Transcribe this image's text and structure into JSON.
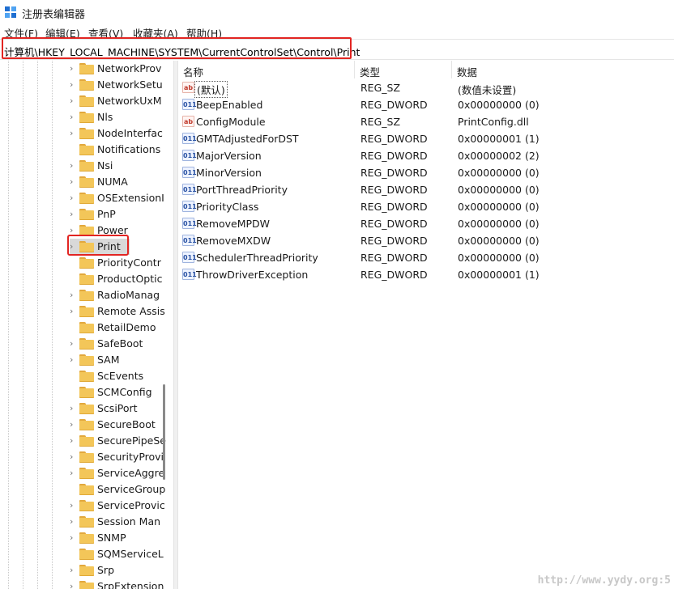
{
  "window": {
    "title": "注册表编辑器",
    "icon": "registry-editor-icon"
  },
  "menu": [
    "文件(F)",
    "编辑(E)",
    "查看(V)",
    "收藏夹(A)",
    "帮助(H)"
  ],
  "address": "计算机\\HKEY_LOCAL_MACHINE\\SYSTEM\\CurrentControlSet\\Control\\Print",
  "tree": {
    "items": [
      {
        "label": "NetworkProv",
        "expandable": true
      },
      {
        "label": "NetworkSetu",
        "expandable": true
      },
      {
        "label": "NetworkUxM",
        "expandable": true
      },
      {
        "label": "Nls",
        "expandable": true
      },
      {
        "label": "NodeInterfac",
        "expandable": true
      },
      {
        "label": "Notifications",
        "expandable": false
      },
      {
        "label": "Nsi",
        "expandable": true
      },
      {
        "label": "NUMA",
        "expandable": true
      },
      {
        "label": "OSExtensionI",
        "expandable": true
      },
      {
        "label": "PnP",
        "expandable": true
      },
      {
        "label": "Power",
        "expandable": true
      },
      {
        "label": "Print",
        "expandable": true,
        "selected": true
      },
      {
        "label": "PriorityContr",
        "expandable": false
      },
      {
        "label": "ProductOptic",
        "expandable": false
      },
      {
        "label": "RadioManag",
        "expandable": true
      },
      {
        "label": "Remote Assis",
        "expandable": true
      },
      {
        "label": "RetailDemo",
        "expandable": false
      },
      {
        "label": "SafeBoot",
        "expandable": true
      },
      {
        "label": "SAM",
        "expandable": true
      },
      {
        "label": "ScEvents",
        "expandable": false
      },
      {
        "label": "SCMConfig",
        "expandable": false
      },
      {
        "label": "ScsiPort",
        "expandable": true
      },
      {
        "label": "SecureBoot",
        "expandable": true
      },
      {
        "label": "SecurePipeSe",
        "expandable": true
      },
      {
        "label": "SecurityProvi",
        "expandable": true
      },
      {
        "label": "ServiceAggre",
        "expandable": true
      },
      {
        "label": "ServiceGroup",
        "expandable": false
      },
      {
        "label": "ServiceProvic",
        "expandable": true
      },
      {
        "label": "Session Man",
        "expandable": true
      },
      {
        "label": "SNMP",
        "expandable": true
      },
      {
        "label": "SQMServiceL",
        "expandable": false
      },
      {
        "label": "Srp",
        "expandable": true
      },
      {
        "label": "SrpExtension",
        "expandable": true
      }
    ]
  },
  "columns": {
    "name": "名称",
    "type": "类型",
    "data": "数据"
  },
  "values": [
    {
      "icon": "string-value-icon",
      "name": "(默认)",
      "type": "REG_SZ",
      "data": "(数值未设置)",
      "default": true
    },
    {
      "icon": "dword-value-icon",
      "name": "BeepEnabled",
      "type": "REG_DWORD",
      "data": "0x00000000 (0)"
    },
    {
      "icon": "string-value-icon",
      "name": "ConfigModule",
      "type": "REG_SZ",
      "data": "PrintConfig.dll"
    },
    {
      "icon": "dword-value-icon",
      "name": "GMTAdjustedForDST",
      "type": "REG_DWORD",
      "data": "0x00000001 (1)"
    },
    {
      "icon": "dword-value-icon",
      "name": "MajorVersion",
      "type": "REG_DWORD",
      "data": "0x00000002 (2)"
    },
    {
      "icon": "dword-value-icon",
      "name": "MinorVersion",
      "type": "REG_DWORD",
      "data": "0x00000000 (0)"
    },
    {
      "icon": "dword-value-icon",
      "name": "PortThreadPriority",
      "type": "REG_DWORD",
      "data": "0x00000000 (0)"
    },
    {
      "icon": "dword-value-icon",
      "name": "PriorityClass",
      "type": "REG_DWORD",
      "data": "0x00000000 (0)"
    },
    {
      "icon": "dword-value-icon",
      "name": "RemoveMPDW",
      "type": "REG_DWORD",
      "data": "0x00000000 (0)"
    },
    {
      "icon": "dword-value-icon",
      "name": "RemoveMXDW",
      "type": "REG_DWORD",
      "data": "0x00000000 (0)"
    },
    {
      "icon": "dword-value-icon",
      "name": "SchedulerThreadPriority",
      "type": "REG_DWORD",
      "data": "0x00000000 (0)"
    },
    {
      "icon": "dword-value-icon",
      "name": "ThrowDriverException",
      "type": "REG_DWORD",
      "data": "0x00000001 (1)"
    }
  ],
  "value_icon_text": {
    "sz": "ab",
    "dword": "011"
  },
  "watermark": "http://www.yydy.org:5",
  "colors": {
    "highlight": "#e22522",
    "selection": "#d9d9d9",
    "folder": "#f3c659"
  }
}
